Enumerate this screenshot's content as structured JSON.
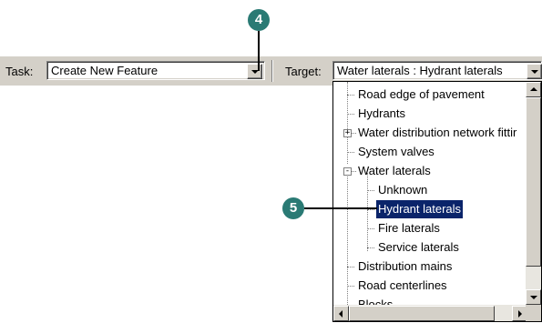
{
  "toolbar": {
    "task_label": "Task:",
    "task_value": "Create New Feature",
    "target_label": "Target:",
    "target_value": "Water laterals : Hydrant laterals"
  },
  "callouts": {
    "step4": "4",
    "step5": "5"
  },
  "tree": {
    "items": [
      {
        "label": "Road  edge of pavement"
      },
      {
        "label": "Hydrants"
      },
      {
        "label": "Water distribution network fittir",
        "expander": "+"
      },
      {
        "label": "System valves"
      },
      {
        "label": "Water laterals",
        "expander": "-"
      },
      {
        "label": "Unknown"
      },
      {
        "label": "Hydrant laterals",
        "selected": true
      },
      {
        "label": "Fire laterals"
      },
      {
        "label": "Service laterals"
      },
      {
        "label": "Distribution mains"
      },
      {
        "label": "Road centerlines"
      },
      {
        "label": "Blocks"
      }
    ]
  },
  "colors": {
    "callout": "#2a7a74",
    "selection": "#0a246a",
    "chrome": "#d4d0c8"
  }
}
